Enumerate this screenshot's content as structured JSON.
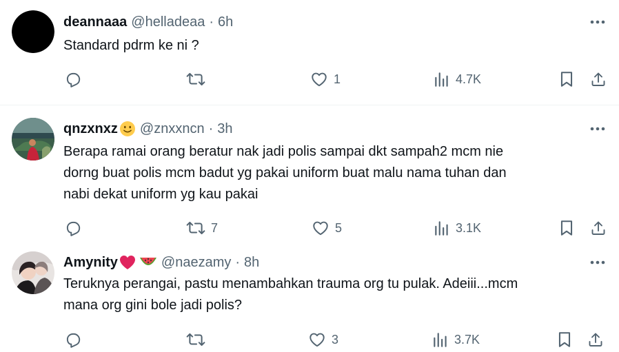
{
  "tweets": [
    {
      "name": "deannaaa",
      "handle": "@helladeaa",
      "separator": "·",
      "time": "6h",
      "text_lines": [
        "Standard pdrm ke ni ?"
      ],
      "reply_count": "",
      "retweet_count": "",
      "like_count": "1",
      "view_count": "4.7K",
      "avatar_color": "#000000"
    },
    {
      "name": "qnzxnxz",
      "handle": "@znxxncn",
      "separator": "·",
      "time": "3h",
      "text_lines": [
        "Berapa ramai orang beratur nak jadi polis sampai dkt sampah2 mcm nie",
        "dorng buat polis mcm badut yg pakai uniform buat malu nama tuhan dan",
        "nabi dekat uniform yg kau pakai"
      ],
      "reply_count": "",
      "retweet_count": "7",
      "like_count": "5",
      "view_count": "3.1K",
      "name_emoji": "slightly-smiling-face-emoji"
    },
    {
      "name": "Amynity",
      "handle": "@naezamy",
      "separator": "·",
      "time": "8h",
      "text_lines": [
        "Teruknya perangai, pastu menambahkan trauma org tu pulak. Adeiii...mcm",
        "mana org gini bole jadi polis?"
      ],
      "reply_count": "",
      "retweet_count": "",
      "like_count": "3",
      "view_count": "3.7K",
      "name_emoji": "red-heart-and-watermelon-emoji"
    }
  ],
  "colors": {
    "text_primary": "#0f1419",
    "text_secondary": "#536471",
    "divider": "#eff3f4",
    "heart_red": "#e0245e",
    "watermelon_green": "#5c9e31",
    "watermelon_red": "#f0424f",
    "emoji_yellow": "#ffcc4d"
  },
  "icons": [
    "reply-icon",
    "retweet-icon",
    "like-icon",
    "views-icon",
    "bookmark-icon",
    "share-icon",
    "more-options-icon"
  ]
}
